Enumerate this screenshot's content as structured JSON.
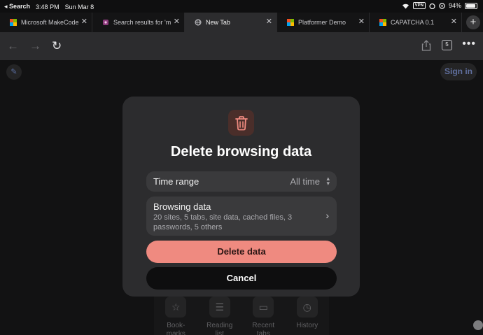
{
  "status_bar": {
    "back_app": "◂ Search",
    "time": "3:48 PM",
    "date": "Sun Mar 8",
    "vpn": "VPN",
    "battery_percent": "94%",
    "battery_level": 0.94
  },
  "tabs": [
    {
      "title": "Microsoft MakeCode",
      "icon": "makecode-logo-icon",
      "active": false
    },
    {
      "title": "Search results for 'm",
      "icon": "search-results-favicon-icon",
      "active": false
    },
    {
      "title": "New Tab",
      "icon": "globe-icon",
      "active": true
    },
    {
      "title": "Platformer Demo",
      "icon": "makecode-logo-icon",
      "active": false
    },
    {
      "title": "CAPATCHA 0.1",
      "icon": "makecode-logo-icon",
      "active": false
    }
  ],
  "toolbar": {
    "tab_count": "5"
  },
  "page": {
    "signin_label": "Sign in",
    "shortcuts": [
      {
        "label": "Book-marks",
        "icon": "star-icon"
      },
      {
        "label": "Reading list",
        "icon": "reading-list-icon"
      },
      {
        "label": "Recent tabs",
        "icon": "recent-tabs-icon"
      },
      {
        "label": "History",
        "icon": "history-icon"
      }
    ]
  },
  "dialog": {
    "title": "Delete browsing data",
    "time_range_label": "Time range",
    "time_range_value": "All time",
    "browsing_data_label": "Browsing data",
    "browsing_data_desc": "20 sites, 5 tabs, site data, cached files, 3 passwords, 5 others",
    "delete_label": "Delete data",
    "cancel_label": "Cancel"
  },
  "colors": {
    "delete_button": "#ef8a80",
    "accent_link": "#9bb4ff",
    "trash_icon": "#ef8a80"
  }
}
